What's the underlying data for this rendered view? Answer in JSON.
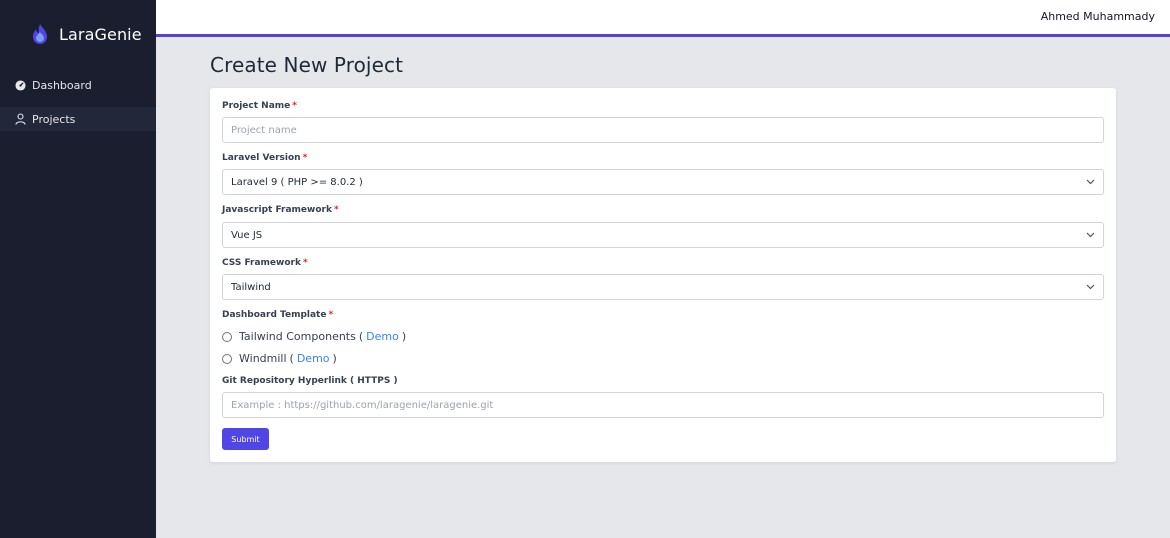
{
  "app": {
    "name": "LaraGenie"
  },
  "sidebar": {
    "items": [
      {
        "label": "Dashboard",
        "icon": "dashboard-gauge-icon",
        "active": false
      },
      {
        "label": "Projects",
        "icon": "user-icon",
        "active": true
      }
    ]
  },
  "header": {
    "user_name": "Ahmed Muhammady"
  },
  "page": {
    "title": "Create New Project"
  },
  "form": {
    "required_marker": "*",
    "project_name": {
      "label": "Project Name",
      "placeholder": "Project name",
      "value": ""
    },
    "laravel_version": {
      "label": "Laravel Version",
      "value": "Laravel 9 ( PHP >= 8.0.2 )"
    },
    "javascript_framework": {
      "label": "Javascript Framework",
      "value": "Vue JS"
    },
    "css_framework": {
      "label": "CSS Framework",
      "value": "Tailwind"
    },
    "dashboard_template": {
      "label": "Dashboard Template",
      "options": [
        {
          "name": "Tailwind Components",
          "open": "(",
          "link": "Demo",
          "close": ")"
        },
        {
          "name": "Windmill",
          "open": "(",
          "link": "Demo",
          "close": ")"
        }
      ]
    },
    "git_repository": {
      "label": "Git Repository Hyperlink ( HTTPS )",
      "placeholder": "Example : https://github.com/laragenie/laragenie.git",
      "value": ""
    },
    "submit_label": "Submit"
  },
  "colors": {
    "sidebar_bg": "#1a1e2e",
    "accent": "#5b3fd6",
    "button": "#4f46e5",
    "link": "#3b82f6",
    "required": "#dc2626"
  }
}
